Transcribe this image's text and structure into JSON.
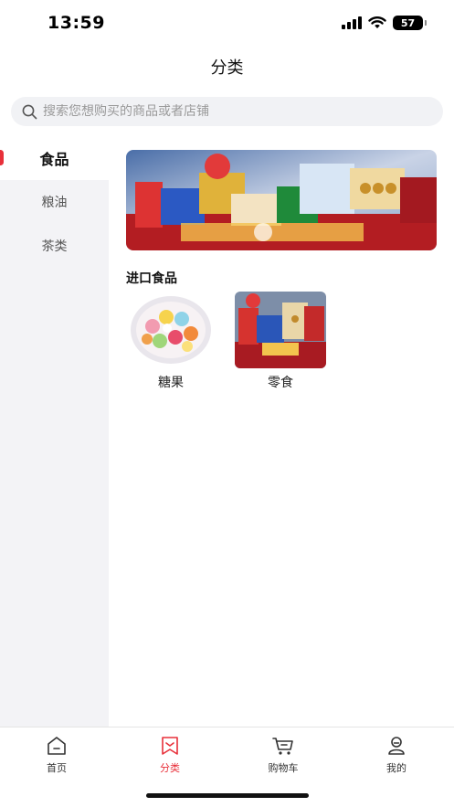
{
  "status": {
    "time": "13:59",
    "battery": "57"
  },
  "header": {
    "title": "分类"
  },
  "search": {
    "placeholder": "搜索您想购买的商品或者店铺"
  },
  "sidebar": {
    "items": [
      {
        "label": "食品",
        "active": true
      },
      {
        "label": "粮油",
        "active": false
      },
      {
        "label": "茶类",
        "active": false
      }
    ]
  },
  "main": {
    "section_title": "进口食品",
    "categories": [
      {
        "label": "糖果",
        "icon": "candy-image"
      },
      {
        "label": "零食",
        "icon": "snacks-image"
      }
    ]
  },
  "tabbar": {
    "items": [
      {
        "label": "首页",
        "icon": "home-icon"
      },
      {
        "label": "分类",
        "icon": "category-icon"
      },
      {
        "label": "购物车",
        "icon": "cart-icon"
      },
      {
        "label": "我的",
        "icon": "profile-icon"
      }
    ],
    "active_index": 1
  },
  "colors": {
    "accent": "#e8303a",
    "sidebar_bg": "#f3f3f6",
    "search_bg": "#f1f2f5"
  }
}
